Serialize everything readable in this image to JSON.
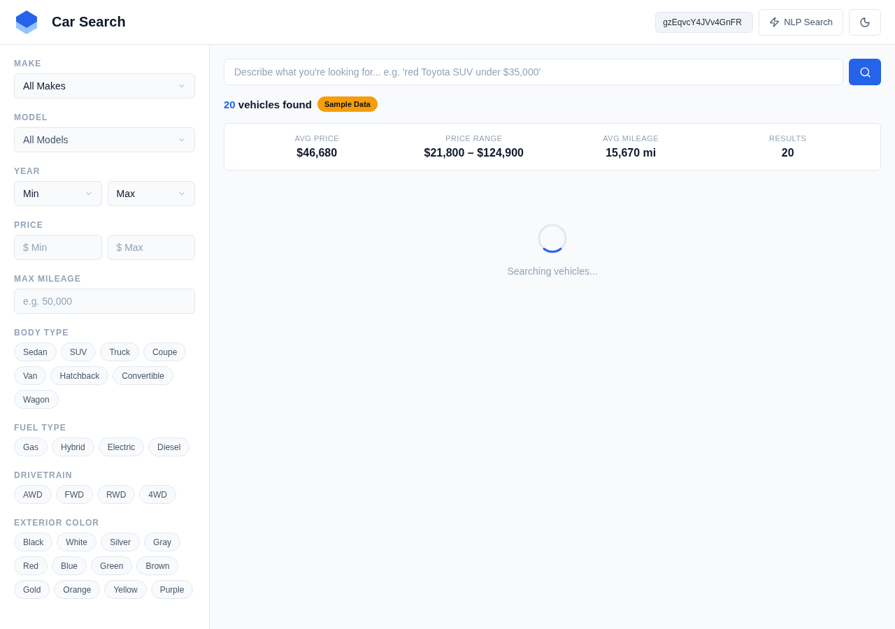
{
  "header": {
    "title": "Car Search",
    "api_key": "gzEqvcY4JVv4GnFR",
    "nlp_button": "NLP Search"
  },
  "filters": [
    {
      "kind": "select",
      "label": "MAKE",
      "fields": [
        {
          "value": "All Makes",
          "disabled": false
        }
      ]
    },
    {
      "kind": "select",
      "label": "MODEL",
      "fields": [
        {
          "value": "All Models",
          "disabled": true
        }
      ]
    },
    {
      "kind": "select",
      "label": "YEAR",
      "fields": [
        {
          "value": "Min",
          "disabled": false
        },
        {
          "value": "Max",
          "disabled": false
        }
      ]
    },
    {
      "kind": "input",
      "label": "PRICE",
      "fields": [
        {
          "placeholder": "$ Min"
        },
        {
          "placeholder": "$ Max"
        }
      ]
    },
    {
      "kind": "input",
      "label": "MAX MILEAGE",
      "fields": [
        {
          "placeholder": "e.g. 50,000"
        }
      ]
    },
    {
      "kind": "chips",
      "label": "BODY TYPE",
      "chips": [
        {
          "label": "Sedan",
          "selected": false
        },
        {
          "label": "SUV",
          "selected": false
        },
        {
          "label": "Truck",
          "selected": false
        },
        {
          "label": "Coupe",
          "selected": false
        },
        {
          "label": "Van",
          "selected": false
        },
        {
          "label": "Hatchback",
          "selected": false
        },
        {
          "label": "Convertible",
          "selected": false
        },
        {
          "label": "Wagon",
          "selected": false
        }
      ]
    },
    {
      "kind": "chips",
      "label": "FUEL TYPE",
      "chips": [
        {
          "label": "Gas",
          "selected": false
        },
        {
          "label": "Hybrid",
          "selected": false
        },
        {
          "label": "Electric",
          "selected": false
        },
        {
          "label": "Diesel",
          "selected": false
        }
      ]
    },
    {
      "kind": "chips",
      "label": "DRIVETRAIN",
      "chips": [
        {
          "label": "AWD",
          "selected": false
        },
        {
          "label": "FWD",
          "selected": false
        },
        {
          "label": "RWD",
          "selected": false
        },
        {
          "label": "4WD",
          "selected": false
        }
      ]
    },
    {
      "kind": "chips",
      "label": "EXTERIOR COLOR",
      "chips": [
        {
          "label": "Black",
          "selected": false
        },
        {
          "label": "White",
          "selected": false
        },
        {
          "label": "Silver",
          "selected": false
        },
        {
          "label": "Gray",
          "selected": false
        },
        {
          "label": "Red",
          "selected": false
        },
        {
          "label": "Blue",
          "selected": false
        },
        {
          "label": "Green",
          "selected": false
        },
        {
          "label": "Brown",
          "selected": false
        },
        {
          "label": "Gold",
          "selected": false
        },
        {
          "label": "Orange",
          "selected": false
        },
        {
          "label": "Yellow",
          "selected": false
        },
        {
          "label": "Purple",
          "selected": false
        }
      ]
    }
  ],
  "search": {
    "placeholder": "Describe what you're looking for... e.g. 'red Toyota SUV under $35,000'"
  },
  "results": {
    "count": "20",
    "label": "vehicles found",
    "badge": "Sample Data"
  },
  "stats": [
    {
      "label": "AVG PRICE",
      "value": "$46,680"
    },
    {
      "label": "PRICE RANGE",
      "value": "$21,800 – $124,900"
    },
    {
      "label": "AVG MILEAGE",
      "value": "15,670 mi"
    },
    {
      "label": "RESULTS",
      "value": "20"
    }
  ],
  "loading": {
    "text": "Searching vehicles..."
  }
}
